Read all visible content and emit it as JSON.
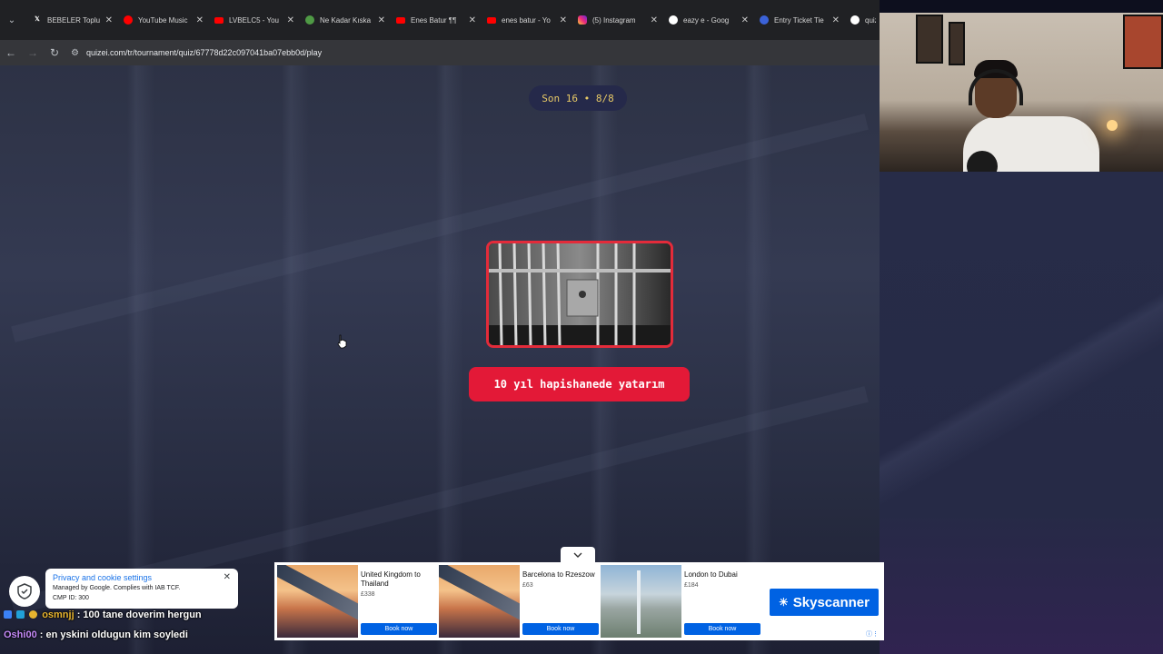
{
  "browser": {
    "tabs": [
      {
        "label": "BEBELER Toplu",
        "favicon": "x-icon"
      },
      {
        "label": "YouTube Music",
        "favicon": "youtube-music-icon"
      },
      {
        "label": "LVBELC5 - You",
        "favicon": "youtube-icon"
      },
      {
        "label": "Ne Kadar Kıska",
        "favicon": "site-icon"
      },
      {
        "label": "Enes Batur ¶¶",
        "favicon": "youtube-icon"
      },
      {
        "label": "enes batur - Yo",
        "favicon": "youtube-icon"
      },
      {
        "label": "(5) Instagram",
        "favicon": "instagram-icon"
      },
      {
        "label": "eazy e - Goog",
        "favicon": "google-icon"
      },
      {
        "label": "Entry Ticket Tie",
        "favicon": "gemini-icon"
      },
      {
        "label": "quiz",
        "favicon": "google-icon"
      }
    ],
    "url": "quizei.com/tr/tournament/quiz/67778d22c097041ba07ebb0d/play"
  },
  "quiz": {
    "round": "Son 16 • 8/8",
    "answer": "10 yıl hapishanede yatarım"
  },
  "cookie": {
    "title": "Privacy and cookie settings",
    "line1": "Managed by Google. Complies with IAB TCF.",
    "line2": "CMP ID: 300"
  },
  "ad": {
    "offers": [
      {
        "route": "United Kingdom to Thailand",
        "price": "£338",
        "button": "Book now"
      },
      {
        "route": "Barcelona to Rzeszow",
        "price": "£63",
        "button": "Book now"
      },
      {
        "route": "London to Dubai",
        "price": "£184",
        "button": "Book now"
      }
    ],
    "brand": "Skyscanner"
  },
  "chat": [
    {
      "user": "osmnjj",
      "message": ": 100 tane doverim hergun"
    },
    {
      "user": "Oshi00",
      "message": ": en yskini oldugun kim soyledi"
    }
  ],
  "colors": {
    "accent": "#e31937",
    "pill_text": "#e6c866",
    "ad_blue": "#0062e3"
  }
}
